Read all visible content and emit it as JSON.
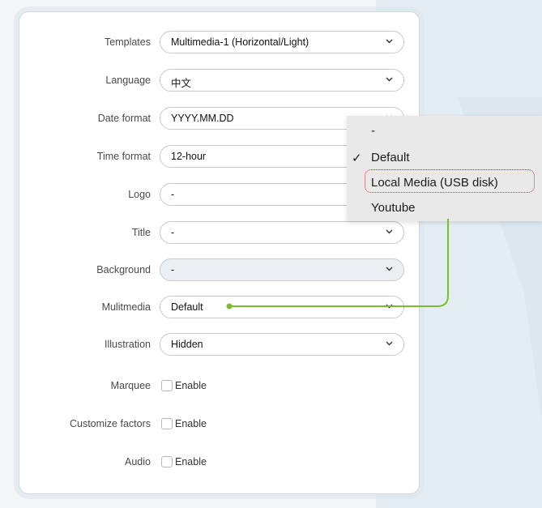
{
  "fields": [
    {
      "label": "Templates",
      "value": "Multimedia-1 (Horizontal/Light)"
    },
    {
      "label": "Language",
      "value": "中文"
    },
    {
      "label": "Date format",
      "value": "YYYY.MM.DD"
    },
    {
      "label": "Time format",
      "value": "12-hour"
    },
    {
      "label": "Logo",
      "value": "-"
    },
    {
      "label": "Title",
      "value": "-"
    },
    {
      "label": "Background",
      "value": "-",
      "disabled": true
    },
    {
      "label": "Mulitmedia",
      "value": "Default"
    },
    {
      "label": "Illustration",
      "value": "Hidden"
    }
  ],
  "checkbox_fields": [
    {
      "label": "Marquee",
      "option": "Enable",
      "checked": false
    },
    {
      "label": "Customize factors",
      "option": "Enable",
      "checked": false
    },
    {
      "label": "Audio",
      "option": "Enable",
      "checked": false
    }
  ],
  "dropdown_menu": {
    "items": [
      "-",
      "Default",
      "Local Media (USB disk)",
      "Youtube"
    ],
    "selected": "Default",
    "checkmark": "✓",
    "highlighted": "Local Media (USB disk)"
  },
  "colors": {
    "accent_connector": "#7cbd2c",
    "highlight_border": "#d9262f"
  },
  "icons": {
    "select_arrow": "chevron-down-icon",
    "menu_check": "checkmark-icon"
  }
}
